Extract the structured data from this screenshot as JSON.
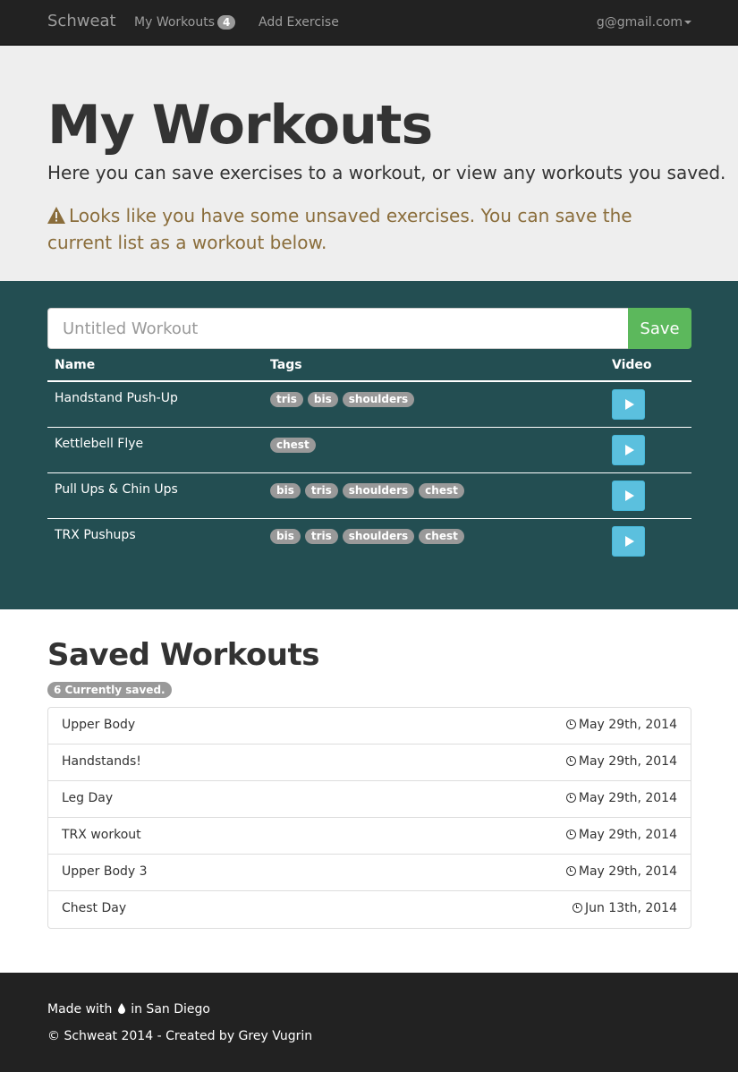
{
  "nav": {
    "brand": "Schweat",
    "workouts_label": "My Workouts",
    "workouts_count": "4",
    "add_label": "Add Exercise",
    "user": "g@gmail.com"
  },
  "header": {
    "title": "My Workouts",
    "lead": "Here you can save exercises to a workout, or view any workouts you saved.",
    "warning": "Looks like you have some unsaved exercises. You can save the current list as a workout below."
  },
  "form": {
    "placeholder": "Untitled Workout",
    "save_label": "Save"
  },
  "table": {
    "headers": [
      "Name",
      "Tags",
      "Video"
    ],
    "rows": [
      {
        "name": "Handstand Push-Up",
        "tags": [
          "tris",
          "bis",
          "shoulders"
        ]
      },
      {
        "name": "Kettlebell Flye",
        "tags": [
          "chest"
        ]
      },
      {
        "name": "Pull Ups & Chin Ups",
        "tags": [
          "bis",
          "tris",
          "shoulders",
          "chest"
        ]
      },
      {
        "name": "TRX Pushups",
        "tags": [
          "bis",
          "tris",
          "shoulders",
          "chest"
        ]
      }
    ]
  },
  "saved": {
    "title": "Saved Workouts",
    "badge": "6 Currently saved.",
    "items": [
      {
        "name": "Upper Body",
        "date": "May 29th, 2014"
      },
      {
        "name": "Handstands!",
        "date": "May 29th, 2014"
      },
      {
        "name": "Leg Day",
        "date": "May 29th, 2014"
      },
      {
        "name": "TRX workout",
        "date": "May 29th, 2014"
      },
      {
        "name": "Upper Body 3",
        "date": "May 29th, 2014"
      },
      {
        "name": "Chest Day",
        "date": "Jun 13th, 2014"
      }
    ]
  },
  "footer": {
    "made_prefix": "Made with",
    "made_suffix": "in San Diego",
    "copyright": "© Schweat 2014 - Created by Grey Vugrin"
  },
  "icons": {
    "warning": "warning-icon",
    "play": "play-icon",
    "clock": "clock-icon",
    "drop": "drop-icon",
    "caret": "caret-down-icon"
  },
  "colors": {
    "navbar": "#222222",
    "jumbotron": "#eeeeee",
    "panel": "#234e52",
    "save": "#5cb85c",
    "play": "#5bc0de",
    "badge": "#999999",
    "warning_text": "#8a6d3b"
  }
}
